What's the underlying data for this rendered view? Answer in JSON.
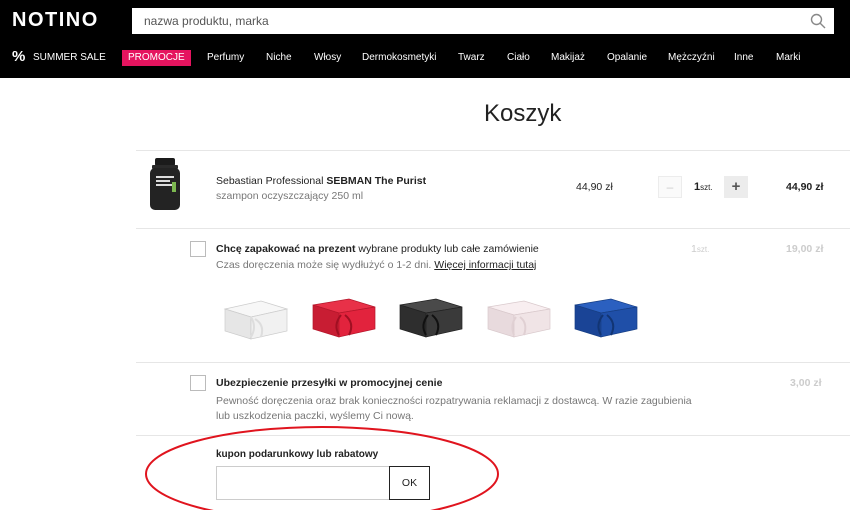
{
  "header": {
    "logo": "NOTINO",
    "search_placeholder": "nazwa produktu, marka"
  },
  "nav": {
    "sale_icon": "%",
    "sale_label": "SUMMER SALE",
    "promo_label": "PROMOCJE",
    "items": [
      "Perfumy",
      "Niche",
      "Włosy",
      "Dermokosmetyki",
      "Twarz",
      "Ciało",
      "Makijaż",
      "Opalanie",
      "Mężczyźni",
      "Inne",
      "Marki"
    ]
  },
  "page": {
    "title": "Koszyk"
  },
  "cart": {
    "product": {
      "brand": "Sebastian Professional",
      "name": "SEBMAN The Purist",
      "description": "szampon oczyszczający 250 ml",
      "price": "44,90 zł",
      "qty_minus": "–",
      "qty": "1",
      "qty_unit": "szt.",
      "qty_plus": "+",
      "total": "44,90 zł"
    },
    "gift_wrap": {
      "title_bold": "Chcę zapakować na prezent",
      "title_rest": "wybrane produkty lub całe zamówienie",
      "subtitle": "Czas doręczenia może się wydłużyć o 1-2 dni.",
      "link": "Więcej informacji tutaj",
      "qty": "1",
      "qty_unit": "szt.",
      "price": "19,00 zł",
      "box_colors": [
        "#f1f1f1",
        "#e2233d",
        "#3a3a3a",
        "#f0e4e6",
        "#1f4fa8"
      ]
    },
    "insurance": {
      "title": "Ubezpieczenie przesyłki w promocyjnej cenie",
      "description": "Pewność doręczenia oraz brak konieczności rozpatrywania reklamacji z dostawcą. W razie zagubienia lub uszkodzenia paczki, wyślemy Ci nową.",
      "price": "3,00 zł"
    },
    "coupon": {
      "label": "kupon podarunkowy lub rabatowy",
      "input_value": "",
      "button_label": "OK"
    }
  },
  "colors": {
    "accent": "#e5145f",
    "annotation": "#e0141e",
    "topbar": "#000000"
  }
}
